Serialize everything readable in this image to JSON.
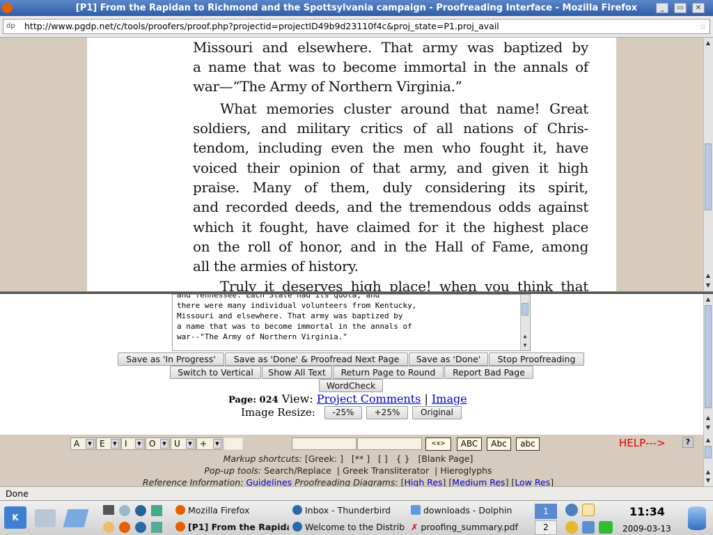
{
  "window": {
    "title": "[P1] From the Rapidan to Richmond and the Spottsylvania campaign - Proofreading Interface - Mozilla Firefox"
  },
  "url": "http://www.pgdp.net/c/tools/proofers/proof.php?projectid=projectID49b9d23110f4c&proj_state=P1.proj_avail",
  "url_icon": "dp",
  "scan_lines": [
    "Missouri and elsewhere.  That army was baptized by",
    "a name that was to become immortal in the annals of",
    "war—“The Army of Northern Virginia.”",
    "What memories cluster around that name!  Great",
    "soldiers, and military critics of all nations of Chris-",
    "tendom, including even the men who fought it, have",
    "voiced their opinion of that army, and given it high",
    "praise.  Many of them, duly considering its spirit,",
    "and recorded deeds, and the tremendous odds against",
    "which it fought, have claimed for it the highest place",
    "on the roll of honor, and in the Hall of Fame, among",
    "all the armies of history.",
    "Truly it deserves high place!  when you think that"
  ],
  "editor_text": [
    "and Tennessee. Each State had its quota, and",
    "there were many individual volunteers from Kentucky,",
    "Missouri and elsewhere. That army was baptized by",
    "a name that was to become immortal in the annals of",
    "war--\"The Army of Northern Virginia.\""
  ],
  "buttons": {
    "save_in_progress": "Save as 'In Progress'",
    "save_done_next": "Save as 'Done' & Proofread Next Page",
    "save_done": "Save as 'Done'",
    "stop": "Stop Proofreading",
    "switch_vertical": "Switch to Vertical",
    "show_all": "Show All Text",
    "return_page": "Return Page to Round",
    "report_bad": "Report Bad Page",
    "wordcheck": "WordCheck"
  },
  "page_info": {
    "page_label": "Page: 024",
    "view_label": "View:",
    "project_comments": "Project Comments",
    "sep": "|",
    "image": "Image"
  },
  "resize": {
    "label": "Image Resize:",
    "minus": "-25%",
    "plus": "+25%",
    "original": "Original"
  },
  "toolbar": {
    "selects": [
      "A",
      "E",
      "I",
      "O",
      "U",
      "+"
    ],
    "case_buttons": [
      "<x>",
      "ABC",
      "Abc",
      "abc"
    ],
    "help": "HELP--->",
    "help_icon": "?",
    "markup_label": "Markup shortcuts:",
    "markup_items": "[Greek: ]   [** ]   [ ]   { }   [Blank Page]",
    "popup_label": "Pop-up tools:",
    "popup_items": "Search/Replace  | Greek Transliterator  | Hieroglyphs",
    "ref_label": "Reference Information:",
    "ref_guidelines": "Guidelines",
    "ref_diagrams": "Proofreading Diagrams:",
    "ref_high": "High Res",
    "ref_medium": "Medium Res",
    "ref_low": "Low Res"
  },
  "status": "Done",
  "taskbar": {
    "tasks_top": [
      "Mozilla Firefox",
      "Inbox - Thunderbird",
      "downloads - Dolphin"
    ],
    "tasks_bottom": [
      "[P1] From the Rapida",
      "Welcome to the Distrib",
      "proofing_summary.pdf"
    ],
    "desktop_current": "1",
    "desktop_other": "2",
    "time": "11:34",
    "date": "2009-03-13"
  }
}
